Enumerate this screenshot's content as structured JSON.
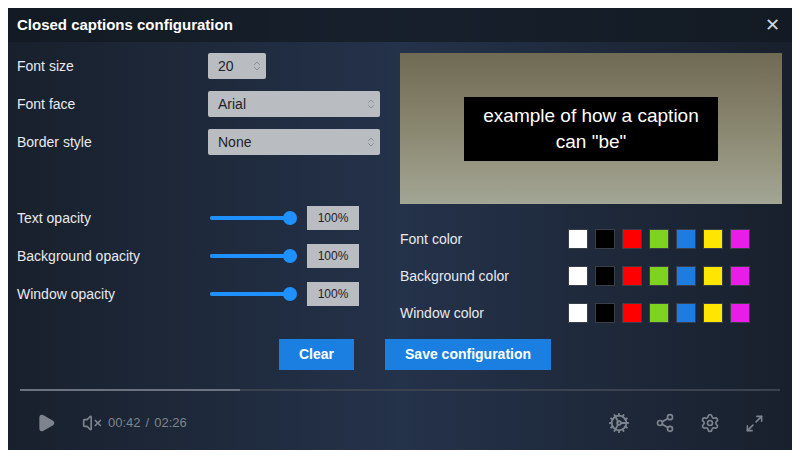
{
  "window": {
    "title": "Closed captions configuration",
    "close": "✕"
  },
  "fields": [
    {
      "label": "Font size",
      "kind": "number",
      "value": "20"
    },
    {
      "label": "Font face",
      "kind": "select",
      "value": "Arial"
    },
    {
      "label": "Border style",
      "kind": "select",
      "value": "None"
    }
  ],
  "sliders": [
    {
      "label": "Text opacity",
      "level": 1,
      "reading": "100%"
    },
    {
      "label": "Background opacity",
      "level": 1,
      "reading": "100%"
    },
    {
      "label": "Window opacity",
      "level": 1,
      "reading": "100%"
    }
  ],
  "preview": {
    "caption": "example of how a caption can \"be\""
  },
  "color_rows": [
    {
      "label": "Font color",
      "swatches": [
        {
          "color": "#ffffff",
          "selected": false
        },
        {
          "color": "#000000",
          "selected": false
        },
        {
          "color": "#ff0000",
          "selected": false
        },
        {
          "color": "#7ed321",
          "selected": false
        },
        {
          "color": "#1e7be0",
          "selected": false
        },
        {
          "color": "#ffe600",
          "selected": false
        },
        {
          "color": "#e81ee8",
          "selected": false
        }
      ]
    },
    {
      "label": "Background color",
      "swatches": [
        {
          "color": "#ffffff",
          "selected": false
        },
        {
          "color": "#000000",
          "selected": false
        },
        {
          "color": "#ff0000",
          "selected": false
        },
        {
          "color": "#7ed321",
          "selected": false
        },
        {
          "color": "#1e7be0",
          "selected": false
        },
        {
          "color": "#ffe600",
          "selected": false
        },
        {
          "color": "#e81ee8",
          "selected": false
        }
      ]
    },
    {
      "label": "Window color",
      "swatches": [
        {
          "color": "#ffffff",
          "selected": false
        },
        {
          "color": "#000000",
          "selected": false
        },
        {
          "color": "#ff0000",
          "selected": false
        },
        {
          "color": "#7ed321",
          "selected": false
        },
        {
          "color": "#1e7be0",
          "selected": false
        },
        {
          "color": "#ffe600",
          "selected": false
        },
        {
          "color": "#e81ee8",
          "selected": false
        }
      ]
    }
  ],
  "buttons": [
    {
      "label": "Clear"
    },
    {
      "label": "Save configuration"
    }
  ],
  "player": {
    "level": 0.29,
    "current_time": "00:42",
    "separator": "/",
    "duration": "02:26"
  }
}
